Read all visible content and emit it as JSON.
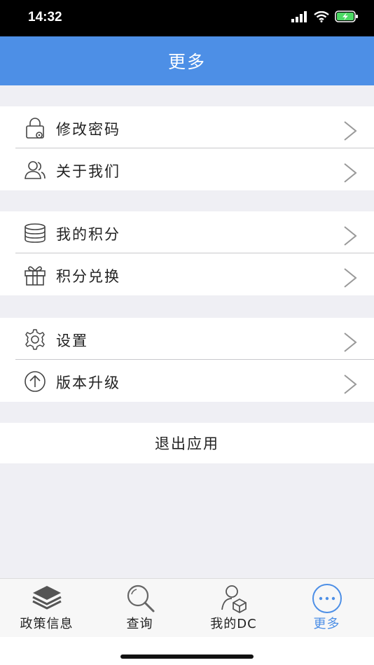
{
  "status": {
    "time": "14:32"
  },
  "nav": {
    "title": "更多"
  },
  "groups": [
    {
      "items": [
        {
          "label": "修改密码",
          "icon": "lock-gear-icon"
        },
        {
          "label": "关于我们",
          "icon": "people-icon"
        }
      ]
    },
    {
      "items": [
        {
          "label": "我的积分",
          "icon": "database-icon"
        },
        {
          "label": "积分兑换",
          "icon": "gift-icon"
        }
      ]
    },
    {
      "items": [
        {
          "label": "设置",
          "icon": "gear-icon"
        },
        {
          "label": "版本升级",
          "icon": "upgrade-arrow-icon"
        }
      ]
    }
  ],
  "logout": {
    "label": "退出应用"
  },
  "tabs": [
    {
      "label": "政策信息",
      "icon": "layers-icon",
      "active": false
    },
    {
      "label": "查询",
      "icon": "search-icon",
      "active": false
    },
    {
      "label": "我的DC",
      "icon": "user-cube-icon",
      "active": false
    },
    {
      "label": "更多",
      "icon": "more-dots-icon",
      "active": true
    }
  ],
  "colors": {
    "accent": "#4d8fe6",
    "background": "#efeff4",
    "status_bar": "#000000"
  }
}
